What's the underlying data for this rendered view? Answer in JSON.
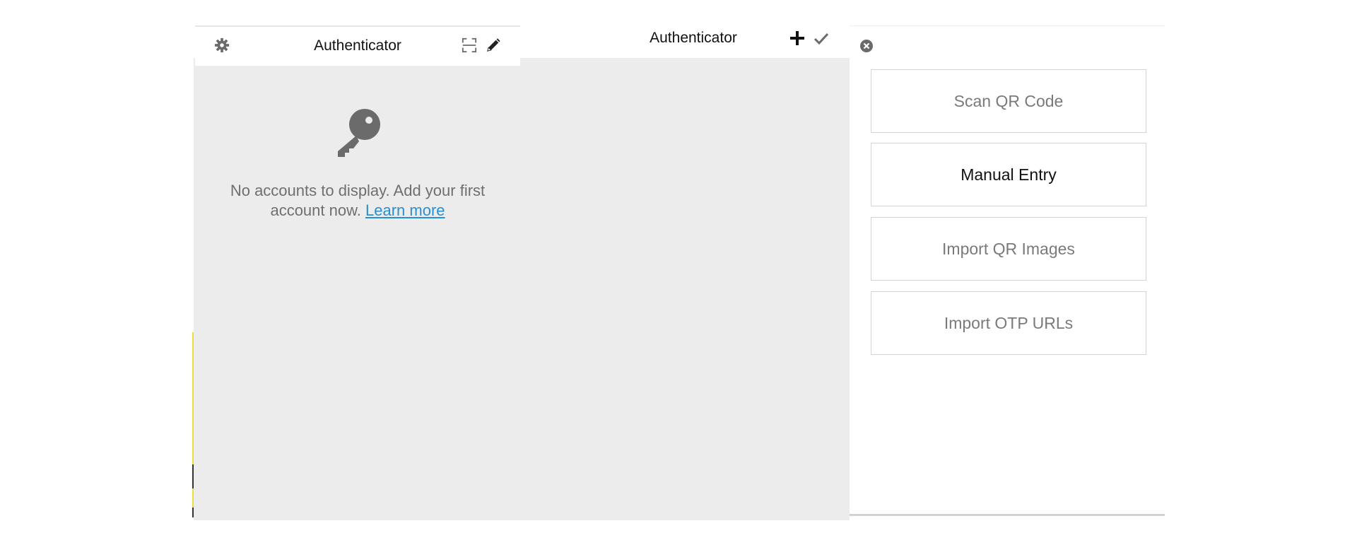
{
  "popup": {
    "title": "Authenticator",
    "icons": [
      "gear-icon",
      "scan-icon",
      "pencil-icon"
    ]
  },
  "empty_state": {
    "message": "No accounts to display. Add your first account now.",
    "link_label": "Learn more",
    "icon": "key-icon"
  },
  "second_window": {
    "title": "Authenticator",
    "icons": [
      "plus-icon",
      "check-icon"
    ]
  },
  "add_menu": {
    "close_icon": "close-circle-icon",
    "items": [
      {
        "label": "Scan QR Code"
      },
      {
        "label": "Manual Entry"
      },
      {
        "label": "Import QR Images"
      },
      {
        "label": "Import OTP URLs"
      }
    ]
  },
  "colors": {
    "background_grey": "#ececec",
    "link_blue": "#2a8fd0",
    "icon_grey": "#6b6b6b",
    "button_border": "#d4d4d4"
  }
}
